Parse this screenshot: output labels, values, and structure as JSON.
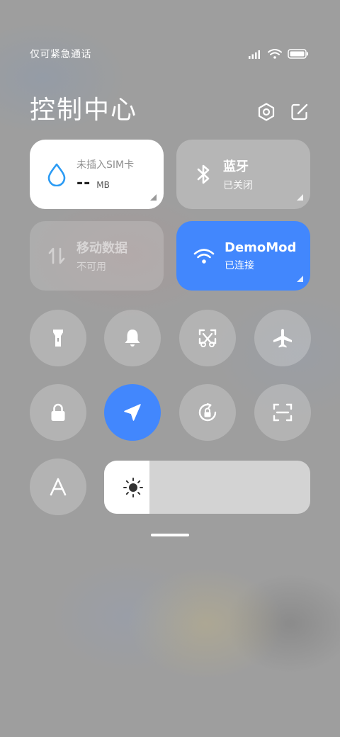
{
  "status_bar": {
    "carrier_text": "仅可紧急通话",
    "icons": [
      "signal-icon",
      "wifi-icon",
      "battery-icon"
    ]
  },
  "header": {
    "title": "控制中心",
    "settings_icon": "settings-icon",
    "edit_icon": "edit-icon"
  },
  "tiles": {
    "data_usage": {
      "label": "未插入SIM卡",
      "value": "--",
      "unit": "MB"
    },
    "bluetooth": {
      "title": "蓝牙",
      "status": "已关闭"
    },
    "mobile_data": {
      "title": "移动数据",
      "status": "不可用"
    },
    "wifi": {
      "title": "DemoMode",
      "status": "已连接"
    }
  },
  "toggles": [
    {
      "name": "flashlight",
      "active": false
    },
    {
      "name": "mute",
      "active": false
    },
    {
      "name": "screenshot",
      "active": false
    },
    {
      "name": "airplane-mode",
      "active": false
    },
    {
      "name": "lock-screen",
      "active": false
    },
    {
      "name": "location",
      "active": true
    },
    {
      "name": "auto-rotate",
      "active": false
    },
    {
      "name": "scanner",
      "active": false
    },
    {
      "name": "text-size",
      "active": false
    }
  ],
  "brightness": {
    "level": 0.1
  },
  "colors": {
    "accent": "#4287fd",
    "tile_white": "#ffffff",
    "tile_glass": "rgba(255,255,255,0.25)",
    "droplet": "#2b9bf4",
    "background": "#9e9e9e"
  }
}
